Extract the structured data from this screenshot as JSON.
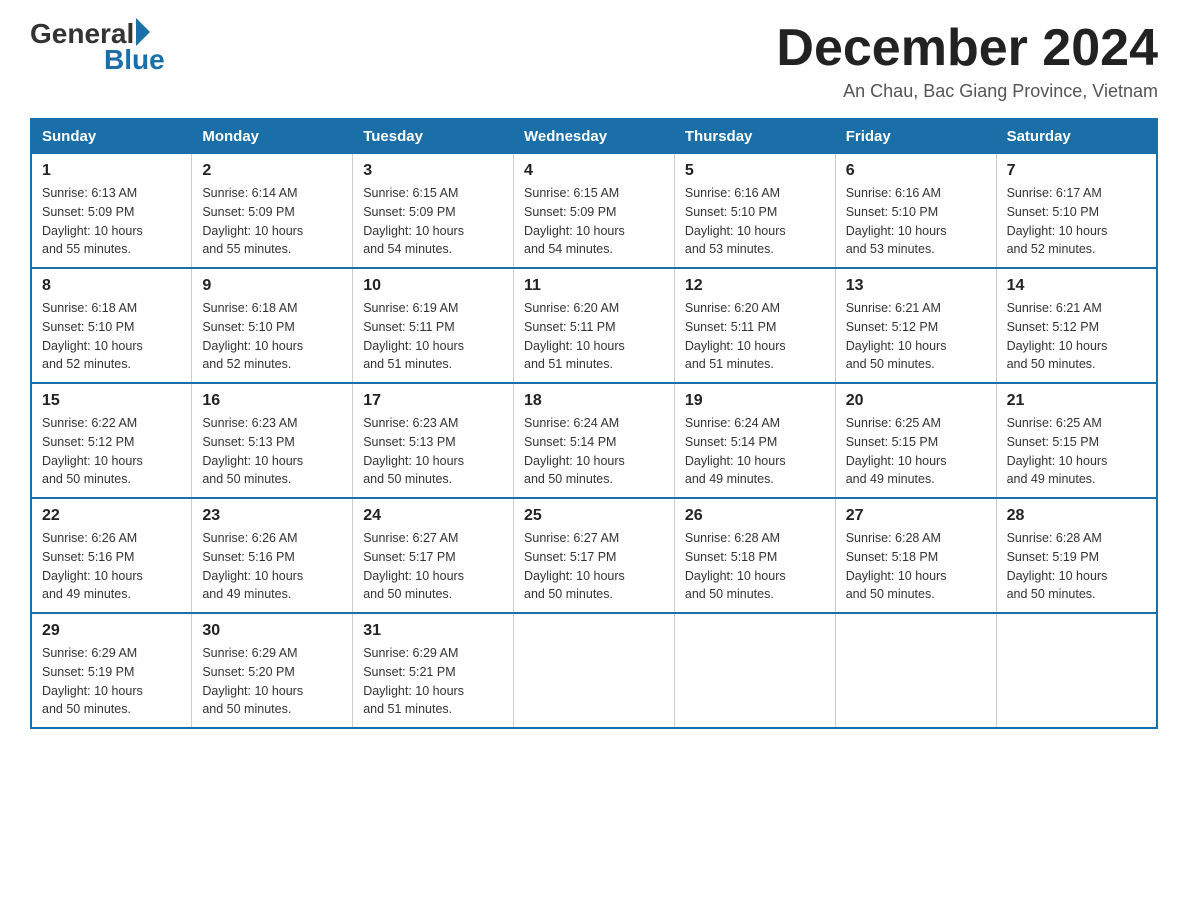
{
  "logo": {
    "general": "General",
    "blue": "Blue",
    "tagline": "Blue"
  },
  "header": {
    "month_year": "December 2024",
    "location": "An Chau, Bac Giang Province, Vietnam"
  },
  "days_of_week": [
    "Sunday",
    "Monday",
    "Tuesday",
    "Wednesday",
    "Thursday",
    "Friday",
    "Saturday"
  ],
  "weeks": [
    [
      {
        "day": "1",
        "sunrise": "6:13 AM",
        "sunset": "5:09 PM",
        "daylight": "10 hours and 55 minutes."
      },
      {
        "day": "2",
        "sunrise": "6:14 AM",
        "sunset": "5:09 PM",
        "daylight": "10 hours and 55 minutes."
      },
      {
        "day": "3",
        "sunrise": "6:15 AM",
        "sunset": "5:09 PM",
        "daylight": "10 hours and 54 minutes."
      },
      {
        "day": "4",
        "sunrise": "6:15 AM",
        "sunset": "5:09 PM",
        "daylight": "10 hours and 54 minutes."
      },
      {
        "day": "5",
        "sunrise": "6:16 AM",
        "sunset": "5:10 PM",
        "daylight": "10 hours and 53 minutes."
      },
      {
        "day": "6",
        "sunrise": "6:16 AM",
        "sunset": "5:10 PM",
        "daylight": "10 hours and 53 minutes."
      },
      {
        "day": "7",
        "sunrise": "6:17 AM",
        "sunset": "5:10 PM",
        "daylight": "10 hours and 52 minutes."
      }
    ],
    [
      {
        "day": "8",
        "sunrise": "6:18 AM",
        "sunset": "5:10 PM",
        "daylight": "10 hours and 52 minutes."
      },
      {
        "day": "9",
        "sunrise": "6:18 AM",
        "sunset": "5:10 PM",
        "daylight": "10 hours and 52 minutes."
      },
      {
        "day": "10",
        "sunrise": "6:19 AM",
        "sunset": "5:11 PM",
        "daylight": "10 hours and 51 minutes."
      },
      {
        "day": "11",
        "sunrise": "6:20 AM",
        "sunset": "5:11 PM",
        "daylight": "10 hours and 51 minutes."
      },
      {
        "day": "12",
        "sunrise": "6:20 AM",
        "sunset": "5:11 PM",
        "daylight": "10 hours and 51 minutes."
      },
      {
        "day": "13",
        "sunrise": "6:21 AM",
        "sunset": "5:12 PM",
        "daylight": "10 hours and 50 minutes."
      },
      {
        "day": "14",
        "sunrise": "6:21 AM",
        "sunset": "5:12 PM",
        "daylight": "10 hours and 50 minutes."
      }
    ],
    [
      {
        "day": "15",
        "sunrise": "6:22 AM",
        "sunset": "5:12 PM",
        "daylight": "10 hours and 50 minutes."
      },
      {
        "day": "16",
        "sunrise": "6:23 AM",
        "sunset": "5:13 PM",
        "daylight": "10 hours and 50 minutes."
      },
      {
        "day": "17",
        "sunrise": "6:23 AM",
        "sunset": "5:13 PM",
        "daylight": "10 hours and 50 minutes."
      },
      {
        "day": "18",
        "sunrise": "6:24 AM",
        "sunset": "5:14 PM",
        "daylight": "10 hours and 50 minutes."
      },
      {
        "day": "19",
        "sunrise": "6:24 AM",
        "sunset": "5:14 PM",
        "daylight": "10 hours and 49 minutes."
      },
      {
        "day": "20",
        "sunrise": "6:25 AM",
        "sunset": "5:15 PM",
        "daylight": "10 hours and 49 minutes."
      },
      {
        "day": "21",
        "sunrise": "6:25 AM",
        "sunset": "5:15 PM",
        "daylight": "10 hours and 49 minutes."
      }
    ],
    [
      {
        "day": "22",
        "sunrise": "6:26 AM",
        "sunset": "5:16 PM",
        "daylight": "10 hours and 49 minutes."
      },
      {
        "day": "23",
        "sunrise": "6:26 AM",
        "sunset": "5:16 PM",
        "daylight": "10 hours and 49 minutes."
      },
      {
        "day": "24",
        "sunrise": "6:27 AM",
        "sunset": "5:17 PM",
        "daylight": "10 hours and 50 minutes."
      },
      {
        "day": "25",
        "sunrise": "6:27 AM",
        "sunset": "5:17 PM",
        "daylight": "10 hours and 50 minutes."
      },
      {
        "day": "26",
        "sunrise": "6:28 AM",
        "sunset": "5:18 PM",
        "daylight": "10 hours and 50 minutes."
      },
      {
        "day": "27",
        "sunrise": "6:28 AM",
        "sunset": "5:18 PM",
        "daylight": "10 hours and 50 minutes."
      },
      {
        "day": "28",
        "sunrise": "6:28 AM",
        "sunset": "5:19 PM",
        "daylight": "10 hours and 50 minutes."
      }
    ],
    [
      {
        "day": "29",
        "sunrise": "6:29 AM",
        "sunset": "5:19 PM",
        "daylight": "10 hours and 50 minutes."
      },
      {
        "day": "30",
        "sunrise": "6:29 AM",
        "sunset": "5:20 PM",
        "daylight": "10 hours and 50 minutes."
      },
      {
        "day": "31",
        "sunrise": "6:29 AM",
        "sunset": "5:21 PM",
        "daylight": "10 hours and 51 minutes."
      },
      null,
      null,
      null,
      null
    ]
  ],
  "labels": {
    "sunrise": "Sunrise:",
    "sunset": "Sunset:",
    "daylight": "Daylight:"
  }
}
